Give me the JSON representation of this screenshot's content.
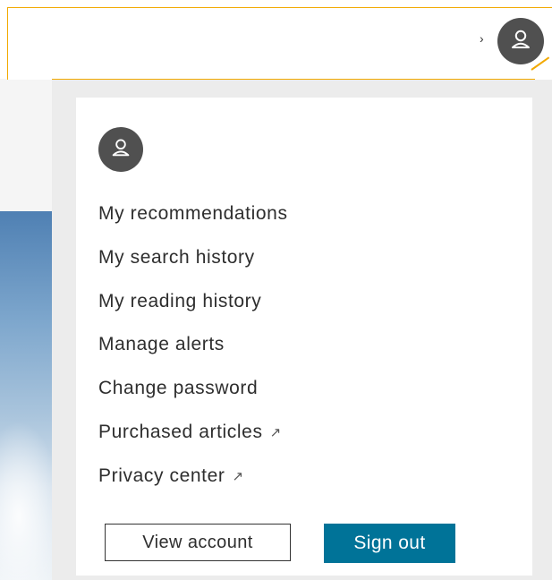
{
  "header": {
    "chevron": "›",
    "avatar_icon": "person-icon"
  },
  "menu": {
    "avatar_icon": "person-icon",
    "items": [
      {
        "label": "My recommendations",
        "external": false
      },
      {
        "label": "My search history",
        "external": false
      },
      {
        "label": "My reading history",
        "external": false
      },
      {
        "label": "Manage alerts",
        "external": false
      },
      {
        "label": "Change password",
        "external": false
      },
      {
        "label": "Purchased articles",
        "external": true,
        "ext_glyph": "↗"
      },
      {
        "label": "Privacy center",
        "external": true,
        "ext_glyph": "↗"
      }
    ],
    "view_account_label": "View account",
    "sign_out_label": "Sign out"
  },
  "colors": {
    "accent_orange": "#f2a900",
    "avatar_bg": "#505050",
    "primary_button": "#007398"
  }
}
